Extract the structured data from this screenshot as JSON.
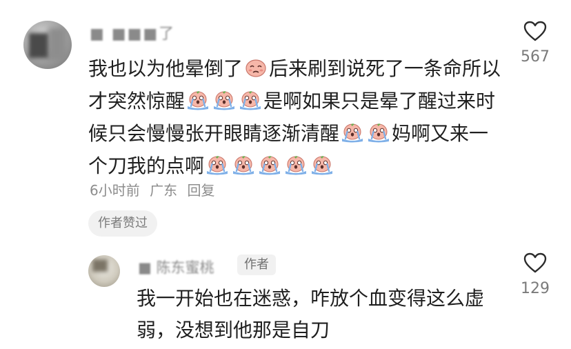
{
  "comment": {
    "username": "■ ■■■了",
    "text_parts": [
      {
        "type": "text",
        "value": "我也以为他晕倒了"
      },
      {
        "type": "emoji",
        "name": "sad-face-emoji"
      },
      {
        "type": "text",
        "value": "后来刷到说死了一条命所以才突然惊醒"
      },
      {
        "type": "emoji",
        "name": "crying-face-emoji"
      },
      {
        "type": "emoji",
        "name": "crying-face-emoji"
      },
      {
        "type": "emoji",
        "name": "crying-face-emoji"
      },
      {
        "type": "text",
        "value": "是啊如果只是晕了醒过来时候只会慢慢张开眼睛逐渐清醒"
      },
      {
        "type": "emoji",
        "name": "crying-face-emoji"
      },
      {
        "type": "emoji",
        "name": "crying-face-emoji"
      },
      {
        "type": "text",
        "value": "妈啊又来一个刀我的点啊"
      },
      {
        "type": "emoji",
        "name": "crying-face-emoji"
      },
      {
        "type": "emoji",
        "name": "crying-face-emoji"
      },
      {
        "type": "emoji",
        "name": "crying-face-emoji"
      },
      {
        "type": "emoji",
        "name": "crying-face-emoji"
      },
      {
        "type": "emoji",
        "name": "crying-face-emoji"
      }
    ],
    "time": "6小时前",
    "location": "广东",
    "reply_label": "回复",
    "author_liked_label": "作者赞过",
    "like_count": "567",
    "like_icon": "heart-outline-icon"
  },
  "reply": {
    "username": "■ 陈东蜜桃",
    "author_tag": "作者",
    "text": "我一开始也在迷惑，咋放个血变得这么虚弱，没想到他那是自刀",
    "like_count": "129",
    "like_icon": "heart-outline-icon"
  },
  "colors": {
    "text_primary": "#1f1f1f",
    "text_secondary": "#8c8c8c",
    "badge_bg": "#f1f1f1",
    "emoji_skin": "#f6b7a9",
    "emoji_tears": "#7fb0e8"
  }
}
